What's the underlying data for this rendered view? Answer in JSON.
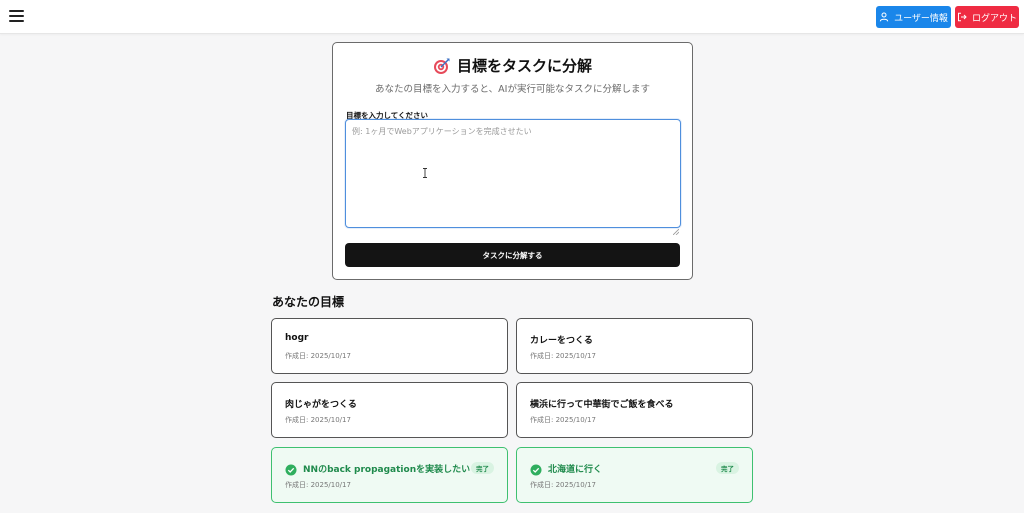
{
  "header": {
    "menu_icon": "hamburger-menu-icon",
    "user_button_label": "ユーザー情報",
    "user_button_color": "#1a86ea",
    "logout_button_label": "ログアウト",
    "logout_button_color": "#ef2b42"
  },
  "form": {
    "title": "目標をタスクに分解",
    "title_icon": "target-icon",
    "subtitle": "あなたの目標を入力すると、AIが実行可能なタスクに分解します",
    "field_label": "目標を入力してください",
    "textarea_value": "",
    "textarea_placeholder": "例: 1ヶ月でWebアプリケーションを完成させたい",
    "submit_label": "タスクに分解する"
  },
  "goals": {
    "heading": "あなたの目標",
    "items": [
      {
        "title": "hogr",
        "date": "作成日: 2025/10/17",
        "done": false
      },
      {
        "title": "カレーをつくる",
        "date": "作成日: 2025/10/17",
        "done": false
      },
      {
        "title": "肉じゃがをつくる",
        "date": "作成日: 2025/10/17",
        "done": false
      },
      {
        "title": "横浜に行って中華街でご飯を食べる",
        "date": "作成日: 2025/10/17",
        "done": false
      },
      {
        "title": "NNのback propagationを実装したい",
        "date": "作成日: 2025/10/17",
        "done": true,
        "badge": "完了"
      },
      {
        "title": "北海道に行く",
        "date": "作成日: 2025/10/17",
        "done": true,
        "badge": "完了"
      }
    ]
  },
  "colors": {
    "done_border": "#3fc070",
    "done_text": "#1f8a4c",
    "done_badge_bg": "#d9f3e2"
  }
}
